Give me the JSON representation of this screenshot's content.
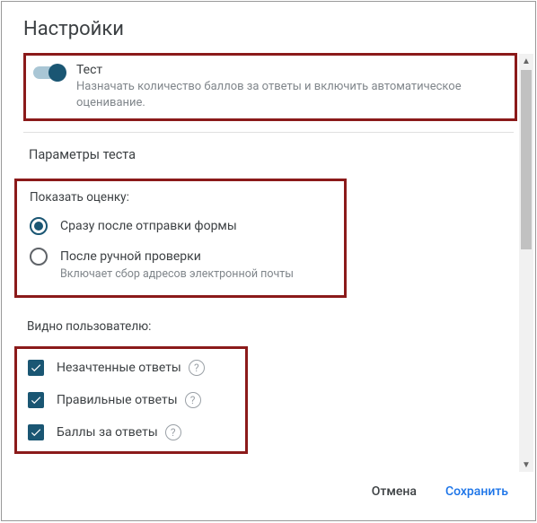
{
  "dialog": {
    "title": "Настройки"
  },
  "test_toggle": {
    "label": "Тест",
    "description": "Назначать количество баллов за ответы и включить автоматическое оценивание."
  },
  "params_header": "Параметры теста",
  "grade_section": {
    "label": "Показать оценку:",
    "options": [
      {
        "label": "Сразу после отправки формы",
        "selected": true
      },
      {
        "label": "После ручной проверки",
        "description": "Включает сбор адресов электронной почты",
        "selected": false
      }
    ]
  },
  "visible_section": {
    "label": "Видно пользователю:",
    "items": [
      {
        "label": "Незачтенные ответы",
        "checked": true
      },
      {
        "label": "Правильные ответы",
        "checked": true
      },
      {
        "label": "Баллы за ответы",
        "checked": true
      }
    ]
  },
  "buttons": {
    "cancel": "Отмена",
    "save": "Сохранить"
  }
}
